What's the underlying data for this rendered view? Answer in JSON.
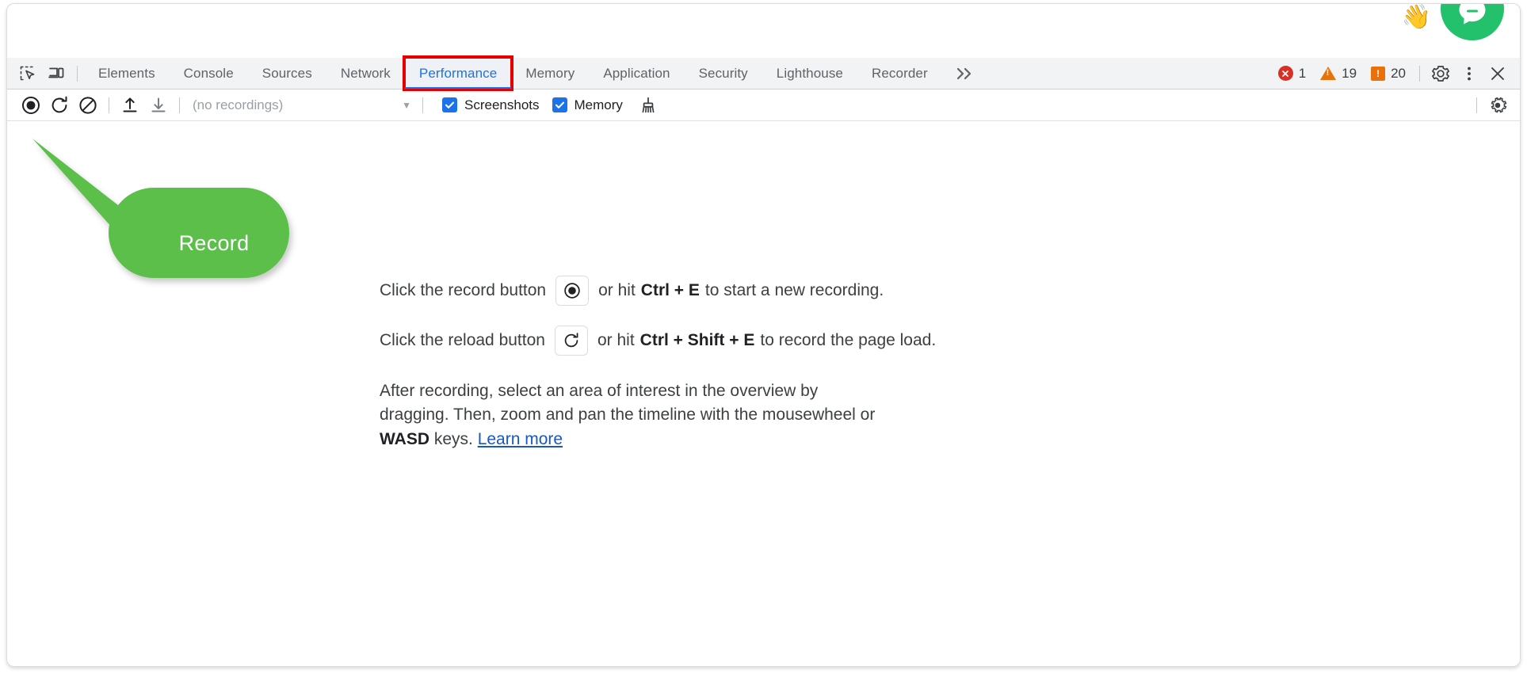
{
  "window": {
    "chat_widget_icon": "chat-bubble-icon",
    "wave_emoji": "👋"
  },
  "devtools": {
    "left_icons": [
      {
        "name": "inspect-element-icon",
        "title": "Inspect element"
      },
      {
        "name": "device-toolbar-icon",
        "title": "Toggle device toolbar"
      }
    ],
    "tabs": [
      {
        "label": "Elements",
        "active": false,
        "highlighted": false
      },
      {
        "label": "Console",
        "active": false,
        "highlighted": false
      },
      {
        "label": "Sources",
        "active": false,
        "highlighted": false
      },
      {
        "label": "Network",
        "active": false,
        "highlighted": false
      },
      {
        "label": "Performance",
        "active": true,
        "highlighted": true
      },
      {
        "label": "Memory",
        "active": false,
        "highlighted": false
      },
      {
        "label": "Application",
        "active": false,
        "highlighted": false
      },
      {
        "label": "Security",
        "active": false,
        "highlighted": false
      },
      {
        "label": "Lighthouse",
        "active": false,
        "highlighted": false
      },
      {
        "label": "Recorder",
        "active": false,
        "highlighted": false
      }
    ],
    "overflow_label": "≫",
    "counters": {
      "errors": "1",
      "warnings": "19",
      "issues": "20",
      "error_glyph": "✕",
      "warning_glyph": "!",
      "issue_glyph": "!"
    },
    "settings_icon": "gear-icon",
    "more_icon": "more-vertical-icon",
    "close_icon": "close-icon"
  },
  "record_toolbar": {
    "buttons": [
      {
        "name": "record-button",
        "title": "Record"
      },
      {
        "name": "reload-and-record-button",
        "title": "Start profiling and reload page"
      },
      {
        "name": "clear-button",
        "title": "Clear"
      },
      {
        "name": "load-profile-button",
        "title": "Load profile"
      },
      {
        "name": "save-profile-button",
        "title": "Save profile"
      }
    ],
    "recordings_value": "(no recordings)",
    "recordings_caret": "▼",
    "screenshots_label": "Screenshots",
    "screenshots_checked": true,
    "memory_label": "Memory",
    "memory_checked": true,
    "garbage_collect_icon": "broom-icon",
    "capture_settings_icon": "gear-icon"
  },
  "landing": {
    "line1_pre": "Click the record button",
    "line1_mid": "or hit",
    "line1_shortcut": "Ctrl + E",
    "line1_post": "to start a new recording.",
    "line2_pre": "Click the reload button",
    "line2_mid": "or hit",
    "line2_shortcut": "Ctrl + Shift + E",
    "line2_post": "to record the page load.",
    "paragraph_part1": "After recording, select an area of interest in the overview by dragging. Then, zoom and pan the timeline with the mousewheel or ",
    "paragraph_keys": "WASD",
    "paragraph_part2": " keys. ",
    "learn_more": "Learn more"
  },
  "annotation": {
    "callout_label": "Record",
    "callout_color": "#5cbf4a"
  }
}
